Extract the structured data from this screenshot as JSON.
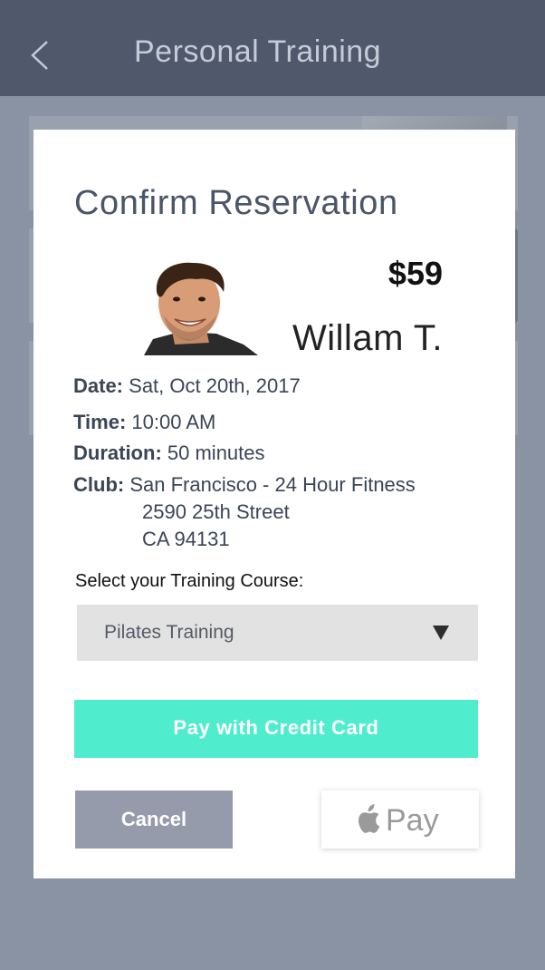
{
  "header": {
    "title": "Personal Training",
    "back_icon": "chevron-left-icon"
  },
  "modal": {
    "title": "Confirm Reservation",
    "price": "$59",
    "trainer_name": "Willam T.",
    "details": {
      "date_label": "Date:",
      "date_value": "Sat, Oct 20th, 2017",
      "time_label": "Time:",
      "time_value": "10:00 AM",
      "duration_label": "Duration:",
      "duration_value": "50 minutes",
      "club_label": "Club:",
      "club_value": "San Francisco - 24 Hour Fitness",
      "address_line1": "2590 25th Street",
      "address_line2": "CA 94131"
    },
    "course": {
      "label": "Select your Training Course:",
      "selected": "Pilates Training",
      "caret_icon": "caret-down-icon"
    },
    "buttons": {
      "pay_credit_card": "Pay with Credit Card",
      "cancel": "Cancel",
      "apple_pay_text": "Pay",
      "apple_icon": "apple-icon"
    }
  },
  "colors": {
    "header_bg": "#4f596b",
    "overlay_bg": "#8a93a3",
    "pay_button": "#4feccd",
    "cancel_button": "#959bab",
    "select_bg": "#e2e2e2"
  }
}
